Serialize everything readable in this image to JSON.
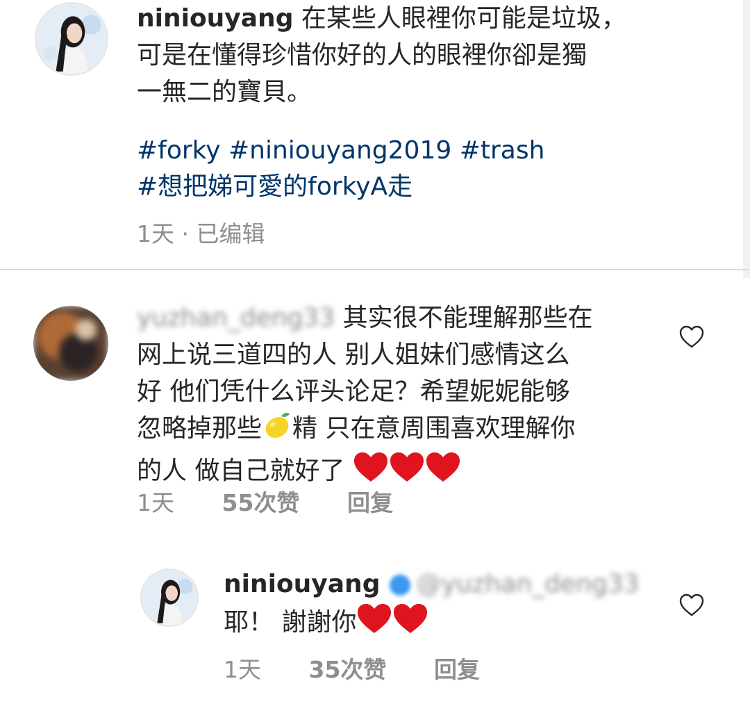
{
  "post": {
    "username": "niniouyang",
    "caption_line1": "在某些人眼裡你可能是垃圾，",
    "caption_line2": "可是在懂得珍惜你好的人的眼裡你卻是獨",
    "caption_line3": "一無二的寶貝。",
    "hashtags_line1": "#forky #niniouyang2019 #trash",
    "hashtags_line2": "#想把娣可愛的forkyA走",
    "meta": "1天 · 已编辑"
  },
  "comment1": {
    "username": "yuzhan_deng33",
    "line1": " 其实很不能理解那些在",
    "line2": "网上说三道四的人 别人姐妹们感情这么",
    "line3": "好 他们凭什么评头论足？希望妮妮能够",
    "line4a": "忽略掉那些",
    "line4b": "精 只在意周围喜欢理解你",
    "line5": "的人 做自己就好了 ",
    "time": "1天",
    "likes": "55次赞",
    "reply": "回复"
  },
  "reply1": {
    "username": "niniouyang",
    "mention": "@yuzhan_deng33",
    "text": "耶！ 謝謝你",
    "time": "1天",
    "likes": "35次赞",
    "reply": "回复"
  },
  "icons": {
    "like": "heart-outline-icon",
    "lemon": "lemon-emoji-icon",
    "red_heart": "red-heart-emoji-icon",
    "verified": "verified-badge-icon"
  },
  "colors": {
    "text": "#262626",
    "hashtag": "#003569",
    "meta": "#8e8e8e",
    "heart_red": "#e0141e",
    "verified": "#3897f0"
  }
}
